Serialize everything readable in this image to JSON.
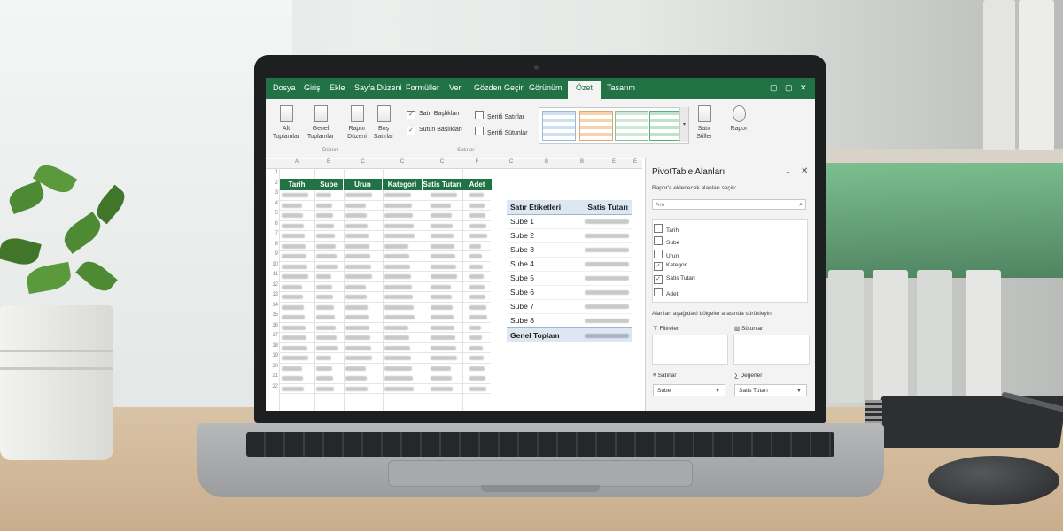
{
  "ribbon": {
    "tabs": [
      "Dosya",
      "Giriş",
      "Ekle",
      "Sayfa Düzeni",
      "Formüller",
      "Veri",
      "Gözden Geçir",
      "Görünüm",
      "Özet",
      "Tasarım"
    ],
    "active_tab": "Özet",
    "buttons": {
      "alt_toplamlar": "Alt Toplamlar",
      "genel_toplamlar": "Genel Toplamlar",
      "rapor_duzeni": "Rapor Düzeni",
      "bos_satirlar": "Boş Satırlar",
      "satir_stiller": "Satır Stiller",
      "rapor": "Rapor"
    },
    "checkboxes": {
      "satir_basliklari": "Satır Başlıkları",
      "sutun_basliklari": "Sütun Başlıkları",
      "seritli_satirlar": "Şeritli Satırlar",
      "seritli_sutunlar": "Şeritli Sütunlar"
    },
    "groups": {
      "duzen": "Düzen",
      "secenekler": "Satırlar"
    }
  },
  "sheet": {
    "column_letters": [
      "A",
      "E",
      "C",
      "C",
      "C",
      "F",
      "C",
      "B",
      "B",
      "E",
      "E"
    ],
    "headers": [
      "Tarih",
      "Sube",
      "Urun",
      "Kategori",
      "Satis Tutarı",
      "Adet"
    ],
    "row_count": 22
  },
  "pivot": {
    "header_label": "Satır Etiketleri",
    "header_value": "Satis Tutarı",
    "rows": [
      "Sube 1",
      "Sube 2",
      "Sube 3",
      "Sube 4",
      "Sube 5",
      "Sube 6",
      "Sube 7",
      "Sube 8"
    ],
    "total_label": "Genel Toplam"
  },
  "pane": {
    "title": "PivotTable Alanları",
    "subtitle": "Rapor'a eklenecek alanları seçin:",
    "search_placeholder": "Ara",
    "fields": [
      {
        "name": "Tarih",
        "checked": false
      },
      {
        "name": "Sube",
        "checked": false
      },
      {
        "name": "Urun",
        "checked": false
      },
      {
        "name": "Kategori",
        "checked": true
      },
      {
        "name": "Satis Tutarı",
        "checked": true
      },
      {
        "name": "Adet",
        "checked": false
      }
    ],
    "drag_hint": "Alanları aşağıdaki bölgeler arasında sürükleyin:",
    "zones": {
      "filters": "Filtreler",
      "columns": "Sütunlar",
      "rows": "Satırlar",
      "values": "Değerler"
    },
    "rows_item": "Sube",
    "values_item": "Satis Tutarı"
  },
  "colors": {
    "excel_green": "#217346",
    "pivot_header": "#dde7f1"
  }
}
